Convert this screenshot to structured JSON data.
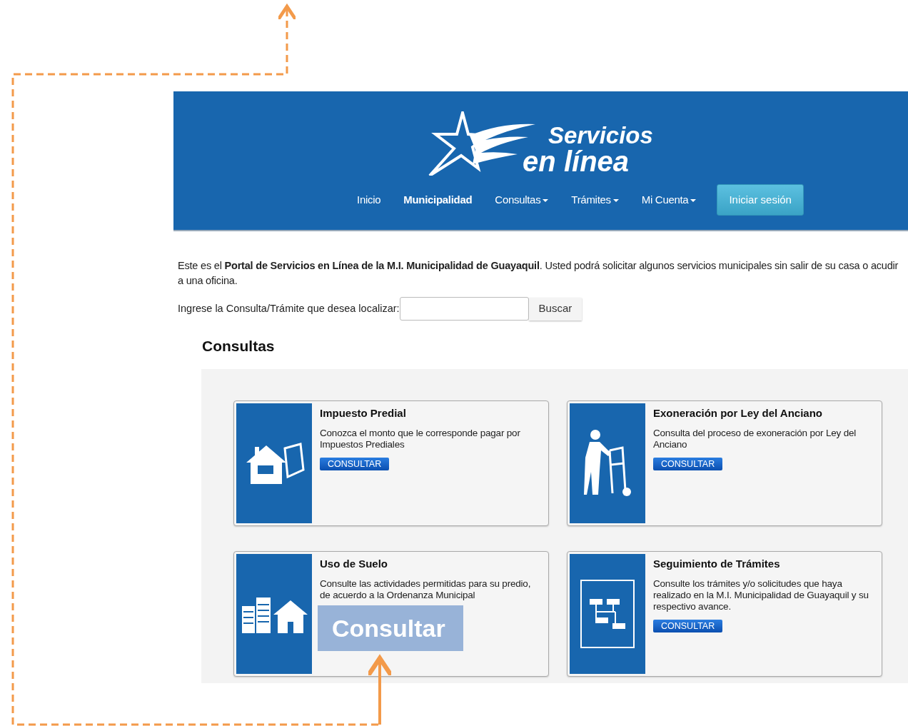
{
  "header": {
    "logo": {
      "line_1": "Servicios",
      "line_2": "en línea"
    },
    "nav": [
      {
        "label": "Inicio",
        "dropdown": false,
        "active": false
      },
      {
        "label": "Municipalidad",
        "dropdown": false,
        "active": true
      },
      {
        "label": "Consultas",
        "dropdown": true,
        "active": false
      },
      {
        "label": "Trámites",
        "dropdown": true,
        "active": false
      },
      {
        "label": "Mi Cuenta",
        "dropdown": true,
        "active": false
      }
    ],
    "login_button": "Iniciar sesión"
  },
  "intro": "Este es el **Portal de Servicios en Línea de la M.I. Municipalidad de Guayaquil**. Usted podrá solicitar algunos servicios municipales sin salir de su casa o acudir a una oficina.",
  "search": {
    "label": "Ingrese la Consulta/Trámite que desea localizar:",
    "button": "Buscar"
  },
  "section_title": "Consultas",
  "cards": [
    {
      "title": "Impuesto Predial",
      "description": "Conozca el monto que le corresponde pagar por Impuestos Prediales",
      "button": "CONSULTAR"
    },
    {
      "title": "Exoneración por Ley del Anciano",
      "description": "Consulta del proceso de exoneración por Ley del Anciano",
      "button": "CONSULTAR"
    },
    {
      "title": "Uso de Suelo",
      "description": "Consulte las actividades permitidas para su predio, de acuerdo a la Ordenanza Municipal"
    },
    {
      "title": "Seguimiento de Trámites",
      "description": "Consulte los trámites y/o solicitudes que haya realizado en la M.I. Municipalidad de Guayaquil y su respectivo avance.",
      "button": "CONSULTAR"
    }
  ],
  "annotation": {
    "callout": "Consultar"
  }
}
